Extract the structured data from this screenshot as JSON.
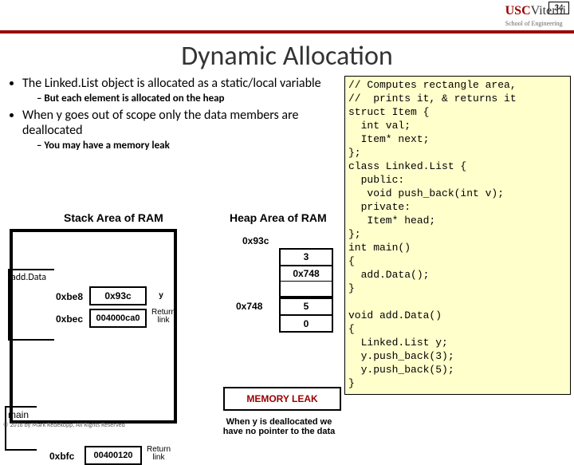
{
  "page_number": "34",
  "logo": {
    "usc": "USC",
    "viterbi": "Viterbi",
    "sub": "School of Engineering"
  },
  "title": "Dynamic Allocation",
  "bullets": {
    "b1": "The Linked.List object is allocated as a static/local variable",
    "b1a": "But each element is allocated on the heap",
    "b2": "When y goes out of scope only the data members are deallocated",
    "b2a": "You may have a memory leak"
  },
  "code": "// Computes rectangle area,\n//  prints it, & returns it\nstruct Item {\n  int val;\n  Item* next;\n};\nclass Linked.List {\n  public:\n   void push_back(int v);\n  private:\n   Item* head;\n};\nint main()\n{\n  add.Data();\n}\n\nvoid add.Data()\n{\n  Linked.List y;\n  y.push_back(3);\n  y.push_back(5);\n}",
  "diagram": {
    "stack_label": "Stack Area of RAM",
    "heap_label": "Heap Area of RAM",
    "addData": "add.Data",
    "addr_be8": "0xbe8",
    "addr_bec": "0xbec",
    "addr_bfc": "0xbfc",
    "val_93c": "0x93c",
    "val_ca0": "004000ca0",
    "val_120": "00400120",
    "y_label": "y",
    "return_link": "Return\nlink",
    "main_label": "main",
    "heap_93c": "0x93c",
    "heap_3": "3",
    "heap_748a": "0x748",
    "heap_748b": "0x748",
    "heap_5": "5",
    "heap_0": "0",
    "memleak": "MEMORY LEAK",
    "memnote": "When y is deallocated we have no pointer to the data"
  },
  "copyright": "© 2016 by Mark Redekopp, All Rights Reserved"
}
